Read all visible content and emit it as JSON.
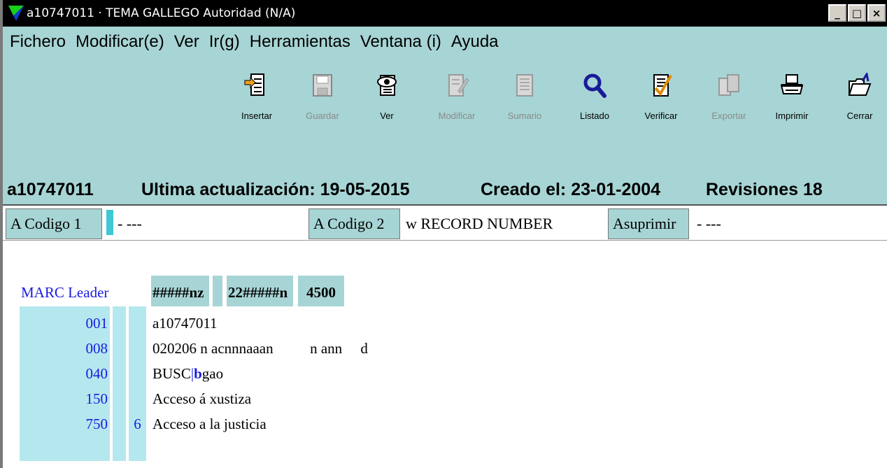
{
  "window": {
    "title": "a10747011 · TEMA GALLEGO Autoridad (N/A)",
    "controls": [
      "_",
      "□",
      "×"
    ]
  },
  "menu": [
    {
      "label": "Fichero",
      "icon": ""
    },
    {
      "label": "Modificar(e)"
    },
    {
      "label": "Ver"
    },
    {
      "label": "Ir(g)"
    },
    {
      "label": "Herramientas"
    },
    {
      "label": "Ventana (i)"
    },
    {
      "label": "Ayuda"
    }
  ],
  "toolbar": [
    {
      "label": "Insertar",
      "icon": "insert-icon",
      "enabled": true
    },
    {
      "label": "Guardar",
      "icon": "save-icon",
      "enabled": false
    },
    {
      "label": "Ver",
      "icon": "view-icon",
      "enabled": true
    },
    {
      "label": "Modificar",
      "icon": "edit-icon",
      "enabled": false
    },
    {
      "label": "Sumario",
      "icon": "summary-icon",
      "enabled": false
    },
    {
      "label": "Listado",
      "icon": "magnifier-icon",
      "enabled": true
    },
    {
      "label": "Verificar",
      "icon": "checklist-icon",
      "enabled": true
    },
    {
      "label": "Exportar",
      "icon": "export-icon",
      "enabled": false
    },
    {
      "label": "Imprimir",
      "icon": "printer-icon",
      "enabled": true
    },
    {
      "label": "Cerrar",
      "icon": "close-folder-icon",
      "enabled": true
    }
  ],
  "record": {
    "id": "a10747011",
    "updated": "Ultima actualización: 19-05-2015",
    "created": "Creado el: 23-01-2004",
    "revisions": "Revisiones 18"
  },
  "codes": {
    "code1_label": "A Codigo 1",
    "code1_value": "-   ---",
    "code2_label": "A Codigo 2",
    "code2_value": "w  RECORD NUMBER",
    "suppress_label": "Asuprimir",
    "suppress_value": "-   ---"
  },
  "marc": {
    "leader_label": "MARC Leader",
    "leader_parts": [
      "#####nz",
      "22#####n",
      "4500"
    ],
    "fields": [
      {
        "tag": "001",
        "ind2": "",
        "value": "a10747011"
      },
      {
        "tag": "008",
        "ind2": "",
        "value": "020206 n acnnnaaan          n ann     d"
      },
      {
        "tag": "040",
        "ind2": "",
        "value_prefix": "BUSC",
        "sep": "|",
        "sub": "b",
        "value_suffix": "gao"
      },
      {
        "tag": "150",
        "ind2": "",
        "value": "Acceso á xustiza"
      },
      {
        "tag": "750",
        "ind2": "6",
        "value": "Acceso a la justicia"
      }
    ]
  },
  "colors": {
    "panel": "#a7d4d4",
    "tag_blue": "#1a1ae0",
    "column_cyan": "#b4e8ee"
  }
}
